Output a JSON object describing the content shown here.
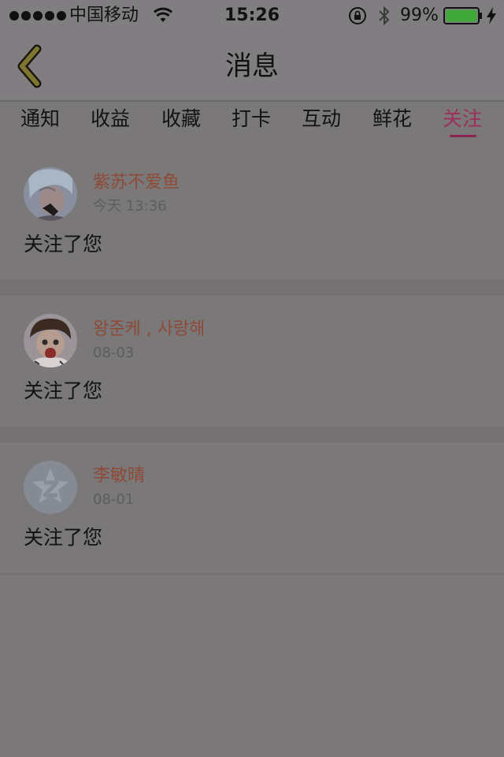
{
  "status_bar": {
    "carrier": "中国移动",
    "time": "15:26",
    "battery": "99%"
  },
  "nav": {
    "title": "消息"
  },
  "tabs": [
    {
      "label": "通知"
    },
    {
      "label": "收益"
    },
    {
      "label": "收藏"
    },
    {
      "label": "打卡"
    },
    {
      "label": "互动"
    },
    {
      "label": "鲜花"
    },
    {
      "label": "关注",
      "active": true
    }
  ],
  "notifications": [
    {
      "user": "紫苏不爱鱼",
      "time": "今天 13:36",
      "message": "关注了您"
    },
    {
      "user": "왕준케 , 사랑해",
      "time": "08-03",
      "message": "关注了您"
    },
    {
      "user": "李敏晴",
      "time": "08-01",
      "message": "关注了您"
    }
  ],
  "colors": {
    "active_tab": "#9c2e5a",
    "user_name": "#8e4a37",
    "battery_fill": "#3fa83a"
  },
  "icons": {
    "back": "chevron-left-icon",
    "wifi": "wifi-icon",
    "orientation_lock": "orientation-lock-icon",
    "bluetooth": "bluetooth-icon",
    "battery": "battery-icon",
    "charging": "charging-bolt-icon"
  }
}
